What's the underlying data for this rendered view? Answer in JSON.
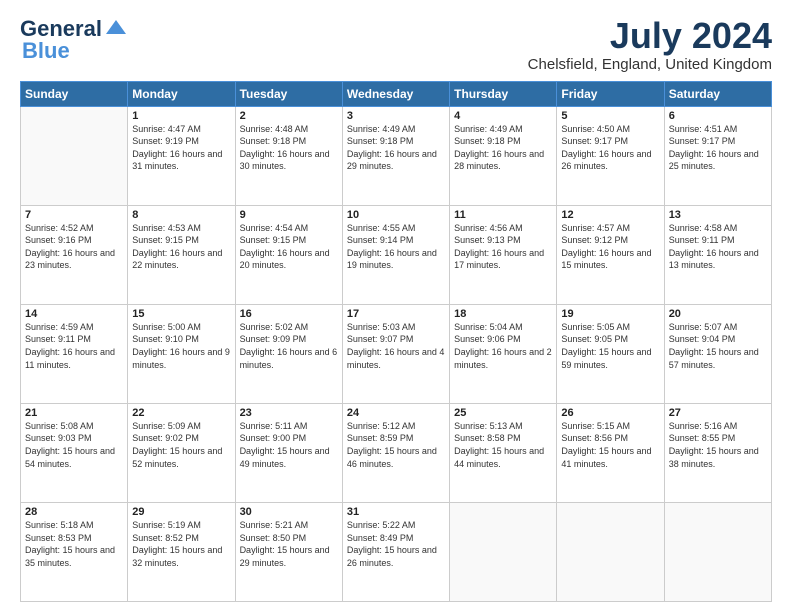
{
  "header": {
    "logo_line1": "General",
    "logo_line2": "Blue",
    "month_title": "July 2024",
    "location": "Chelsfield, England, United Kingdom"
  },
  "days_of_week": [
    "Sunday",
    "Monday",
    "Tuesday",
    "Wednesday",
    "Thursday",
    "Friday",
    "Saturday"
  ],
  "weeks": [
    [
      {
        "day": "",
        "sunrise": "",
        "sunset": "",
        "daylight": ""
      },
      {
        "day": "1",
        "sunrise": "Sunrise: 4:47 AM",
        "sunset": "Sunset: 9:19 PM",
        "daylight": "Daylight: 16 hours and 31 minutes."
      },
      {
        "day": "2",
        "sunrise": "Sunrise: 4:48 AM",
        "sunset": "Sunset: 9:18 PM",
        "daylight": "Daylight: 16 hours and 30 minutes."
      },
      {
        "day": "3",
        "sunrise": "Sunrise: 4:49 AM",
        "sunset": "Sunset: 9:18 PM",
        "daylight": "Daylight: 16 hours and 29 minutes."
      },
      {
        "day": "4",
        "sunrise": "Sunrise: 4:49 AM",
        "sunset": "Sunset: 9:18 PM",
        "daylight": "Daylight: 16 hours and 28 minutes."
      },
      {
        "day": "5",
        "sunrise": "Sunrise: 4:50 AM",
        "sunset": "Sunset: 9:17 PM",
        "daylight": "Daylight: 16 hours and 26 minutes."
      },
      {
        "day": "6",
        "sunrise": "Sunrise: 4:51 AM",
        "sunset": "Sunset: 9:17 PM",
        "daylight": "Daylight: 16 hours and 25 minutes."
      }
    ],
    [
      {
        "day": "7",
        "sunrise": "Sunrise: 4:52 AM",
        "sunset": "Sunset: 9:16 PM",
        "daylight": "Daylight: 16 hours and 23 minutes."
      },
      {
        "day": "8",
        "sunrise": "Sunrise: 4:53 AM",
        "sunset": "Sunset: 9:15 PM",
        "daylight": "Daylight: 16 hours and 22 minutes."
      },
      {
        "day": "9",
        "sunrise": "Sunrise: 4:54 AM",
        "sunset": "Sunset: 9:15 PM",
        "daylight": "Daylight: 16 hours and 20 minutes."
      },
      {
        "day": "10",
        "sunrise": "Sunrise: 4:55 AM",
        "sunset": "Sunset: 9:14 PM",
        "daylight": "Daylight: 16 hours and 19 minutes."
      },
      {
        "day": "11",
        "sunrise": "Sunrise: 4:56 AM",
        "sunset": "Sunset: 9:13 PM",
        "daylight": "Daylight: 16 hours and 17 minutes."
      },
      {
        "day": "12",
        "sunrise": "Sunrise: 4:57 AM",
        "sunset": "Sunset: 9:12 PM",
        "daylight": "Daylight: 16 hours and 15 minutes."
      },
      {
        "day": "13",
        "sunrise": "Sunrise: 4:58 AM",
        "sunset": "Sunset: 9:11 PM",
        "daylight": "Daylight: 16 hours and 13 minutes."
      }
    ],
    [
      {
        "day": "14",
        "sunrise": "Sunrise: 4:59 AM",
        "sunset": "Sunset: 9:11 PM",
        "daylight": "Daylight: 16 hours and 11 minutes."
      },
      {
        "day": "15",
        "sunrise": "Sunrise: 5:00 AM",
        "sunset": "Sunset: 9:10 PM",
        "daylight": "Daylight: 16 hours and 9 minutes."
      },
      {
        "day": "16",
        "sunrise": "Sunrise: 5:02 AM",
        "sunset": "Sunset: 9:09 PM",
        "daylight": "Daylight: 16 hours and 6 minutes."
      },
      {
        "day": "17",
        "sunrise": "Sunrise: 5:03 AM",
        "sunset": "Sunset: 9:07 PM",
        "daylight": "Daylight: 16 hours and 4 minutes."
      },
      {
        "day": "18",
        "sunrise": "Sunrise: 5:04 AM",
        "sunset": "Sunset: 9:06 PM",
        "daylight": "Daylight: 16 hours and 2 minutes."
      },
      {
        "day": "19",
        "sunrise": "Sunrise: 5:05 AM",
        "sunset": "Sunset: 9:05 PM",
        "daylight": "Daylight: 15 hours and 59 minutes."
      },
      {
        "day": "20",
        "sunrise": "Sunrise: 5:07 AM",
        "sunset": "Sunset: 9:04 PM",
        "daylight": "Daylight: 15 hours and 57 minutes."
      }
    ],
    [
      {
        "day": "21",
        "sunrise": "Sunrise: 5:08 AM",
        "sunset": "Sunset: 9:03 PM",
        "daylight": "Daylight: 15 hours and 54 minutes."
      },
      {
        "day": "22",
        "sunrise": "Sunrise: 5:09 AM",
        "sunset": "Sunset: 9:02 PM",
        "daylight": "Daylight: 15 hours and 52 minutes."
      },
      {
        "day": "23",
        "sunrise": "Sunrise: 5:11 AM",
        "sunset": "Sunset: 9:00 PM",
        "daylight": "Daylight: 15 hours and 49 minutes."
      },
      {
        "day": "24",
        "sunrise": "Sunrise: 5:12 AM",
        "sunset": "Sunset: 8:59 PM",
        "daylight": "Daylight: 15 hours and 46 minutes."
      },
      {
        "day": "25",
        "sunrise": "Sunrise: 5:13 AM",
        "sunset": "Sunset: 8:58 PM",
        "daylight": "Daylight: 15 hours and 44 minutes."
      },
      {
        "day": "26",
        "sunrise": "Sunrise: 5:15 AM",
        "sunset": "Sunset: 8:56 PM",
        "daylight": "Daylight: 15 hours and 41 minutes."
      },
      {
        "day": "27",
        "sunrise": "Sunrise: 5:16 AM",
        "sunset": "Sunset: 8:55 PM",
        "daylight": "Daylight: 15 hours and 38 minutes."
      }
    ],
    [
      {
        "day": "28",
        "sunrise": "Sunrise: 5:18 AM",
        "sunset": "Sunset: 8:53 PM",
        "daylight": "Daylight: 15 hours and 35 minutes."
      },
      {
        "day": "29",
        "sunrise": "Sunrise: 5:19 AM",
        "sunset": "Sunset: 8:52 PM",
        "daylight": "Daylight: 15 hours and 32 minutes."
      },
      {
        "day": "30",
        "sunrise": "Sunrise: 5:21 AM",
        "sunset": "Sunset: 8:50 PM",
        "daylight": "Daylight: 15 hours and 29 minutes."
      },
      {
        "day": "31",
        "sunrise": "Sunrise: 5:22 AM",
        "sunset": "Sunset: 8:49 PM",
        "daylight": "Daylight: 15 hours and 26 minutes."
      },
      {
        "day": "",
        "sunrise": "",
        "sunset": "",
        "daylight": ""
      },
      {
        "day": "",
        "sunrise": "",
        "sunset": "",
        "daylight": ""
      },
      {
        "day": "",
        "sunrise": "",
        "sunset": "",
        "daylight": ""
      }
    ]
  ]
}
